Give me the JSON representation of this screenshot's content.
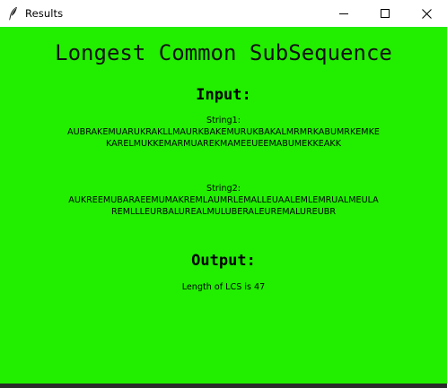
{
  "window": {
    "title": "Results",
    "buttons": {
      "minimize_icon": "minimize-icon",
      "maximize_icon": "maximize-icon",
      "close_icon": "close-icon"
    }
  },
  "colors": {
    "background": "#22ee00"
  },
  "main": {
    "heading": "Longest Common SubSequence",
    "input_title": "Input:",
    "string1_label": "String1:",
    "string1_value": "AUBRAKEMUARUKRAKLLMAURKBAKEMURUKBAKALMRMRKABUMRKEMKEKARELMUKKEMARMUAREKMAMEEUEEMABUMEKKEAKK",
    "string2_label": "String2:",
    "string2_value": "AUKREEMUBARAEEMUMAKREMLAUMRLEMALLEUAALEMLEMRUALMEULAREMLLLEURBALUREALMULUBERALEUREMALUREUBR",
    "output_title": "Output:",
    "result_text": "Length of LCS is 47"
  }
}
